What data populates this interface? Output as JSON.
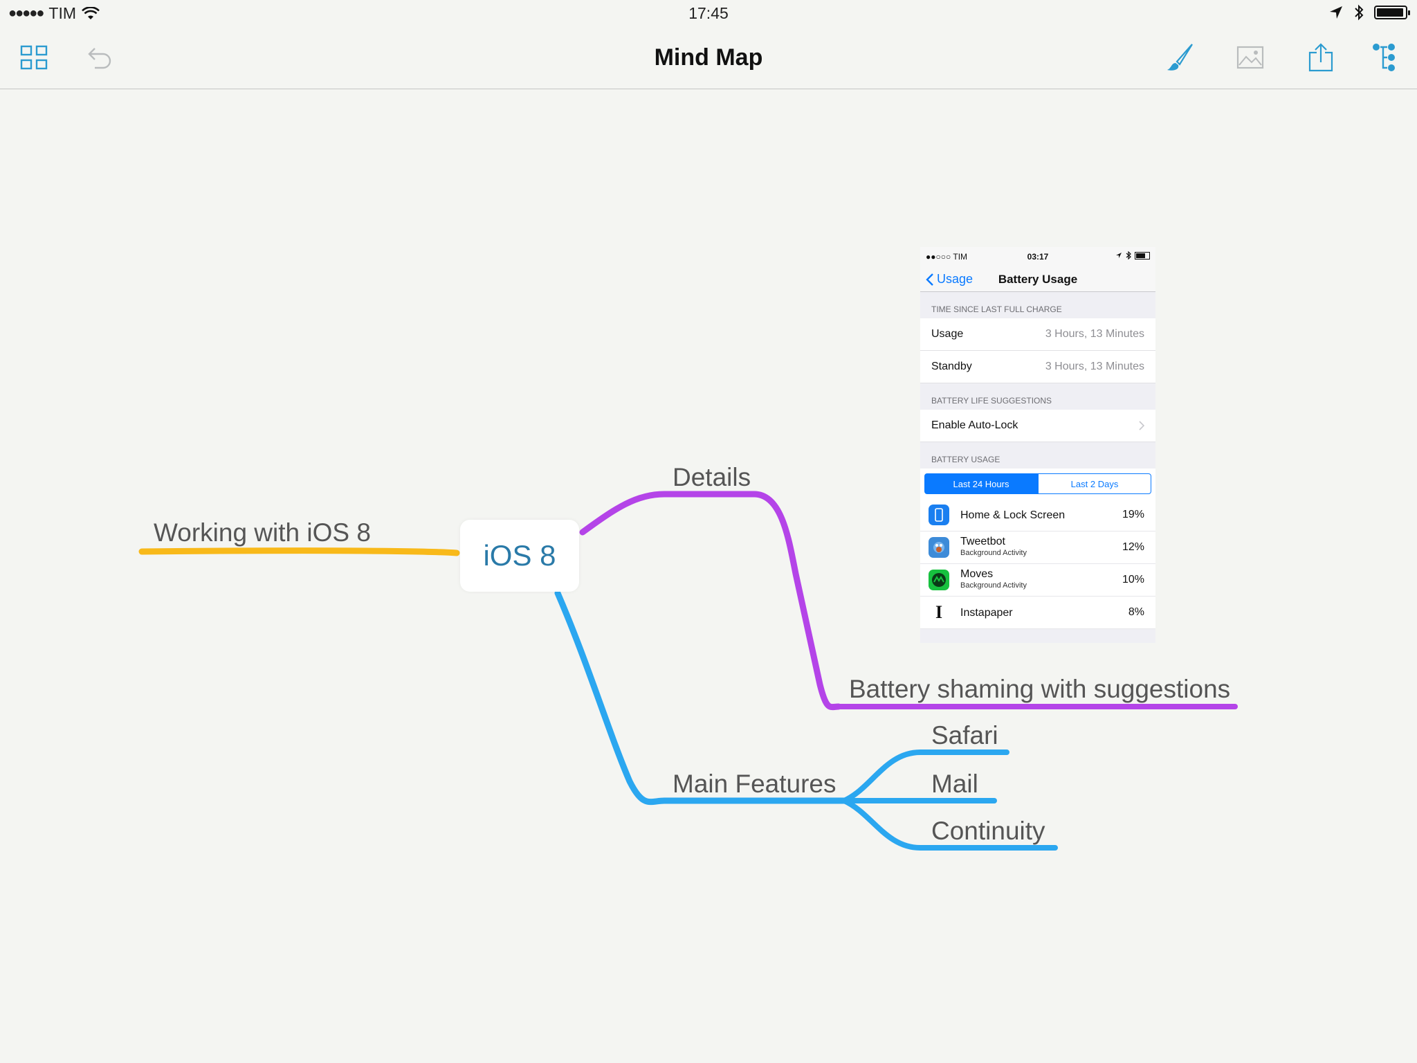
{
  "status_bar": {
    "carrier": "TIM",
    "time": "17:45",
    "battery_level": 0.95
  },
  "nav": {
    "title": "Mind Map",
    "icons": [
      "grid-icon",
      "undo-icon",
      "brush-icon",
      "image-icon",
      "share-icon",
      "outline-icon"
    ]
  },
  "mindmap": {
    "root": "iOS 8",
    "left_branch": "Working with iOS 8",
    "details": "Details",
    "details_child": "Battery shaming with suggestions",
    "main_features": "Main Features",
    "features": [
      "Safari",
      "Mail",
      "Continuity"
    ],
    "colors": {
      "left": "#f8b91a",
      "details": "#b444e8",
      "features": "#2ba7f0"
    }
  },
  "embedded_screenshot": {
    "carrier": "TIM",
    "time": "03:17",
    "back_label": "Usage",
    "title": "Battery Usage",
    "section_time": "TIME SINCE LAST FULL CHARGE",
    "usage_label": "Usage",
    "usage_value": "3 Hours, 13 Minutes",
    "standby_label": "Standby",
    "standby_value": "3 Hours, 13 Minutes",
    "section_suggestions": "BATTERY LIFE SUGGESTIONS",
    "suggestion": "Enable Auto-Lock",
    "section_usage": "BATTERY USAGE",
    "segment_left": "Last 24 Hours",
    "segment_right": "Last 2 Days",
    "apps": [
      {
        "name": "Home & Lock Screen",
        "sub": "",
        "pct": "19%",
        "color": "#1a7ff0"
      },
      {
        "name": "Tweetbot",
        "sub": "Background Activity",
        "pct": "12%",
        "color": "#3d8bd8"
      },
      {
        "name": "Moves",
        "sub": "Background Activity",
        "pct": "10%",
        "color": "#17c13f"
      },
      {
        "name": "Instapaper",
        "sub": "",
        "pct": "8%",
        "color": "#ffffff"
      }
    ]
  }
}
